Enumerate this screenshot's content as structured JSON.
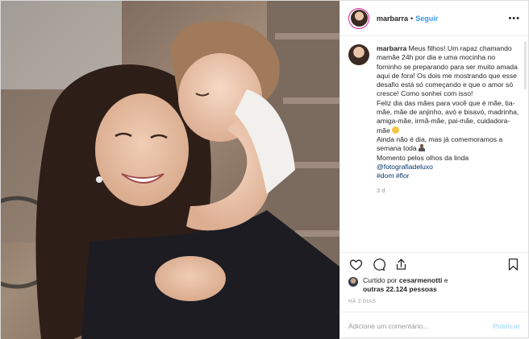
{
  "header": {
    "username": "marbarra",
    "separator": "•",
    "follow_label": "Seguir",
    "more_label": "•••"
  },
  "caption": {
    "username": "marbarra",
    "paragraph1": "Meus filhos! Um rapaz chamando mamãe 24h por dia e uma mocinha no forninho se preparando para ser muito amada aqui de fora! Os dois me mostrando que esse desafio está só começando e que o amor só cresce! Como sonhei com isso!",
    "paragraph2": "Feliz dia das mães para você que é mãe, tia-mãe, mãe de anjinho, avó e bisavó, madrinha, amiga-mãe, irmã-mãe, pai-mãe, cuidadora-mãe",
    "emoji1": "smiling-face",
    "paragraph3a": "Ainda não é dia, mas já comemoramos a semana toda",
    "emoji2": "person",
    "paragraph3b": "Momento pelos olhos da linda",
    "mention": "@fotografiadeluxo",
    "hashtag1": "#dom",
    "hashtag2": "#flor",
    "age": "3 d"
  },
  "actions": {
    "like_icon": "heart-icon",
    "comment_icon": "comment-icon",
    "share_icon": "share-icon",
    "save_icon": "bookmark-icon"
  },
  "likes": {
    "prefix": "Curtido por ",
    "user": "cesarmenotti",
    "middle": " e",
    "others": "outras 22.124 pessoas"
  },
  "timestamp": "HÁ 3 DIAS",
  "comment_box": {
    "placeholder": "Adicione um comentário...",
    "publish_label": "Publicar"
  },
  "colors": {
    "link": "#3897f0",
    "hashtag": "#003569",
    "muted": "#999999",
    "publish_disabled": "#b2dffc"
  }
}
